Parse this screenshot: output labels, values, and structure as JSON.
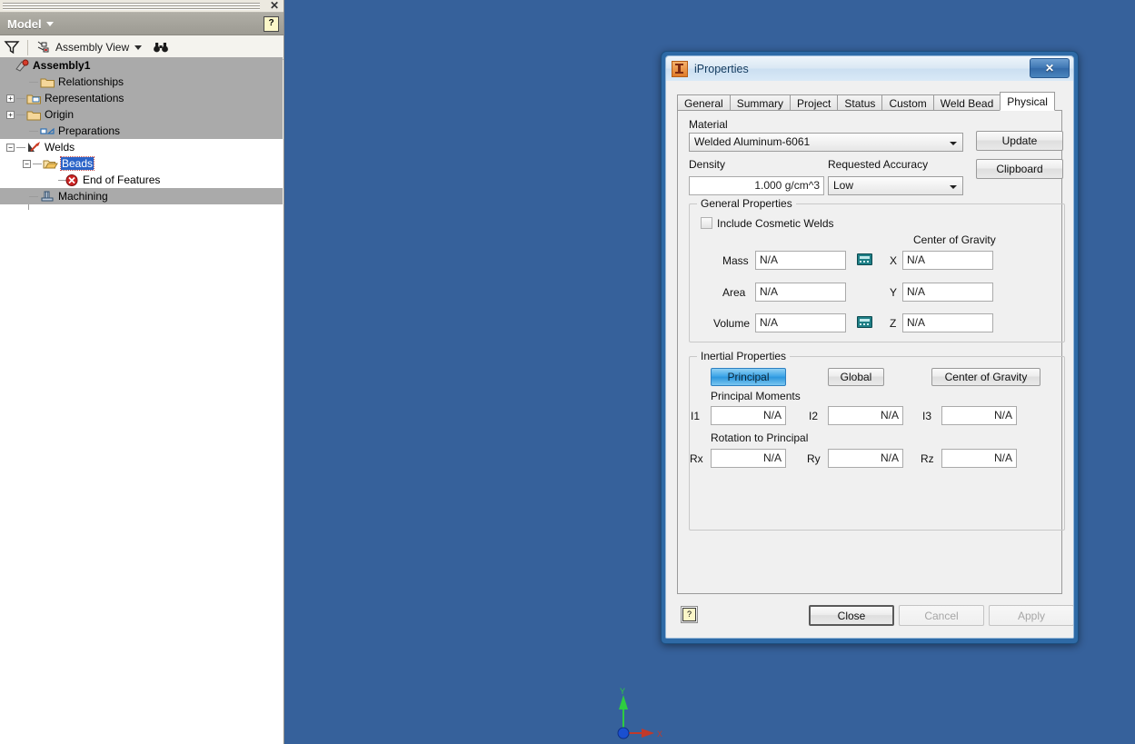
{
  "browser": {
    "close_label": "✕",
    "title": "Model",
    "help_label": "?",
    "toolbar": {
      "filter_icon": "filter-icon",
      "view_label": "Assembly View",
      "find_icon": "binoculars-icon"
    },
    "tree": [
      {
        "label": "Assembly1",
        "icon": "assembly-icon",
        "depth": 0,
        "bold": true,
        "expander": "",
        "row": "dim",
        "selected": false
      },
      {
        "label": "Relationships",
        "icon": "folder-icon",
        "depth": 1,
        "bold": false,
        "expander": "",
        "row": "dim",
        "selected": false
      },
      {
        "label": "Representations",
        "icon": "folder-rep-icon",
        "depth": 1,
        "bold": false,
        "expander": "+",
        "row": "dim",
        "selected": false
      },
      {
        "label": "Origin",
        "icon": "folder-icon",
        "depth": 1,
        "bold": false,
        "expander": "+",
        "row": "dim",
        "selected": false
      },
      {
        "label": "Preparations",
        "icon": "preparations-icon",
        "depth": 1,
        "bold": false,
        "expander": "",
        "row": "dim",
        "selected": false
      },
      {
        "label": "Welds",
        "icon": "welds-icon",
        "depth": 1,
        "bold": false,
        "expander": "−",
        "row": "lit",
        "selected": false
      },
      {
        "label": "Beads",
        "icon": "folder-open-icon",
        "depth": 2,
        "bold": false,
        "expander": "−",
        "row": "lit",
        "selected": true
      },
      {
        "label": "End of Features",
        "icon": "end-of-features-icon",
        "depth": 3,
        "bold": false,
        "expander": "",
        "row": "lit",
        "selected": false
      },
      {
        "label": "Machining",
        "icon": "machining-icon",
        "depth": 1,
        "bold": false,
        "expander": "",
        "row": "dim",
        "selected": false
      }
    ]
  },
  "viewport": {
    "axis_x_label": "X",
    "axis_y_label": "Y",
    "background_color": "#36619b",
    "axis_x_color": "#c0392b",
    "axis_y_color": "#2ecc40",
    "origin_color": "#1a4fd0"
  },
  "dialog": {
    "icon": "inventor-icon",
    "title": "iProperties",
    "close_label": "✕",
    "tabs": [
      {
        "label": "General",
        "active": false
      },
      {
        "label": "Summary",
        "active": false
      },
      {
        "label": "Project",
        "active": false
      },
      {
        "label": "Status",
        "active": false
      },
      {
        "label": "Custom",
        "active": false
      },
      {
        "label": "Weld Bead",
        "active": false
      },
      {
        "label": "Physical",
        "active": true
      }
    ],
    "physical": {
      "material_label": "Material",
      "material_value": "Welded Aluminum-6061",
      "update_label": "Update",
      "clipboard_label": "Clipboard",
      "density_label": "Density",
      "density_value": "1.000 g/cm^3",
      "accuracy_label": "Requested Accuracy",
      "accuracy_value": "Low",
      "general_group_title": "General Properties",
      "include_cosmetic_welds_label": "Include Cosmetic Welds",
      "include_cosmetic_welds_checked": false,
      "center_of_gravity_label": "Center of Gravity",
      "mass_label": "Mass",
      "mass_value": "N/A",
      "area_label": "Area",
      "area_value": "N/A",
      "volume_label": "Volume",
      "volume_value": "N/A",
      "cog_x_label": "X",
      "cog_x_value": "N/A",
      "cog_y_label": "Y",
      "cog_y_value": "N/A",
      "cog_z_label": "Z",
      "cog_z_value": "N/A",
      "inertial_group_title": "Inertial Properties",
      "principal_label": "Principal",
      "global_label": "Global",
      "cog_button_label": "Center of Gravity",
      "principal_moments_label": "Principal Moments",
      "i1_label": "I1",
      "i1_value": "N/A",
      "i2_label": "I2",
      "i2_value": "N/A",
      "i3_label": "I3",
      "i3_value": "N/A",
      "rotation_to_principal_label": "Rotation to Principal",
      "rx_label": "Rx",
      "rx_value": "N/A",
      "ry_label": "Ry",
      "ry_value": "N/A",
      "rz_label": "Rz",
      "rz_value": "N/A"
    },
    "footer": {
      "help_label": "?",
      "close_label": "Close",
      "cancel_label": "Cancel",
      "apply_label": "Apply"
    }
  }
}
